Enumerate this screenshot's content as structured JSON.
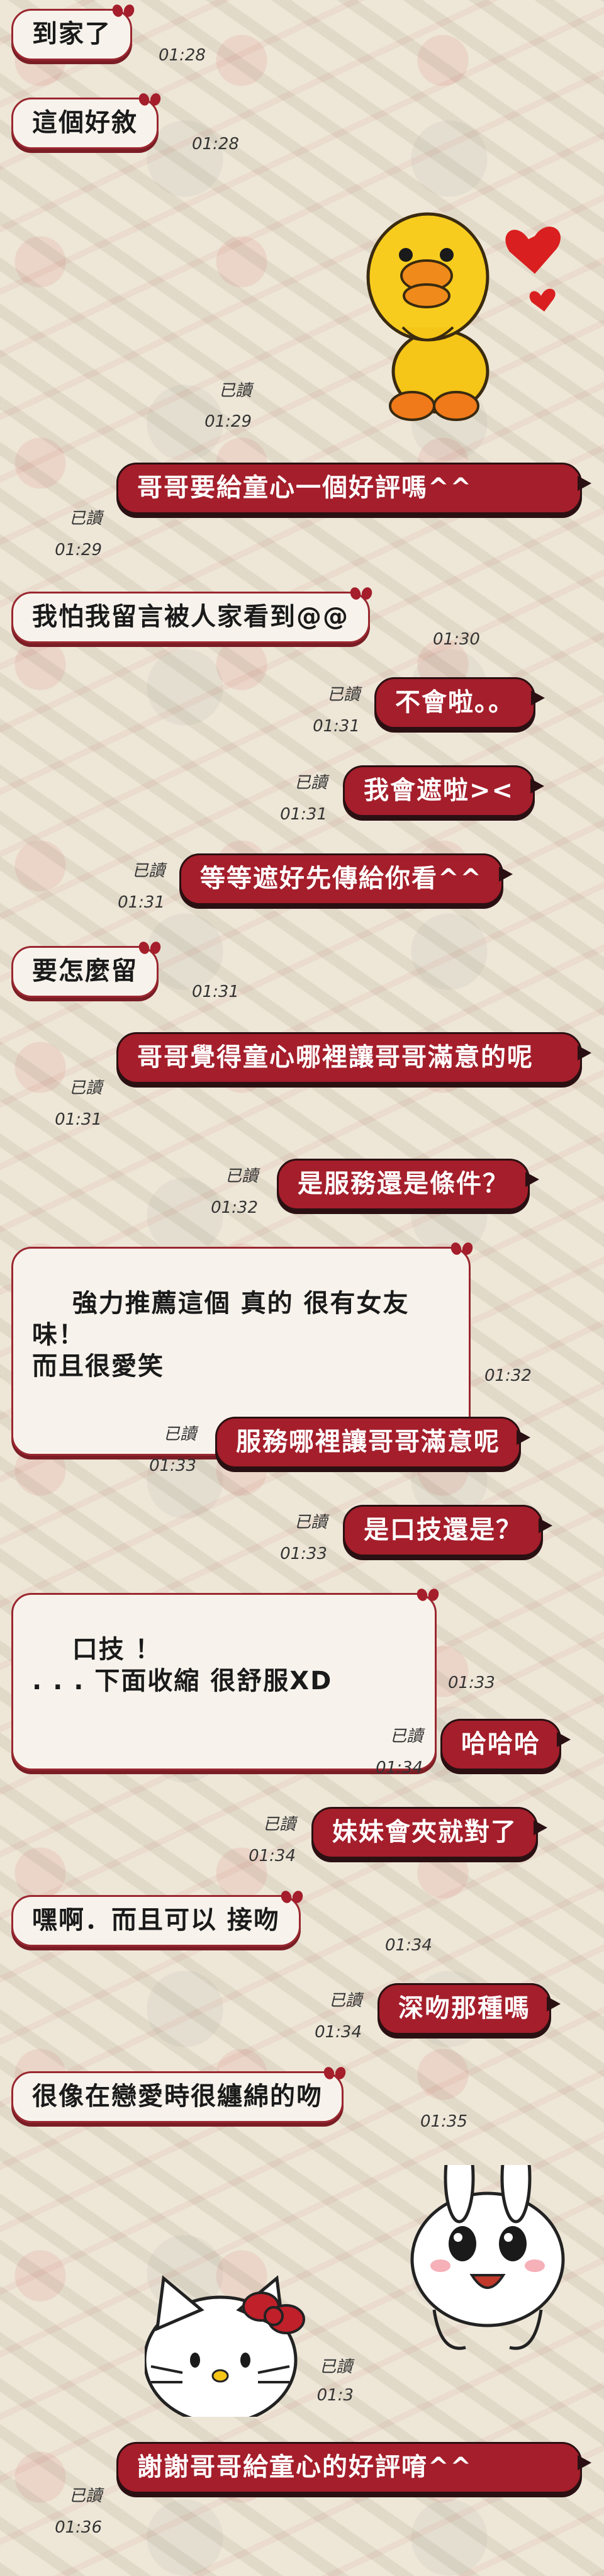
{
  "messages": [
    {
      "side": "in",
      "text": "到家了",
      "time": "01:28"
    },
    {
      "side": "in",
      "text": "這個好敘",
      "time": "01:28"
    },
    {
      "side": "out",
      "sticker": "sally-duck-sticker",
      "read": "已讀",
      "time": "01:29"
    },
    {
      "side": "out",
      "text": "哥哥要給童心一個好評嗎^^",
      "read": "已讀",
      "time": "01:29"
    },
    {
      "side": "in",
      "text": "我怕我留言被人家看到@@",
      "time": "01:30"
    },
    {
      "side": "out",
      "text": "不會啦。。",
      "read": "已讀",
      "time": "01:31"
    },
    {
      "side": "out",
      "text": "我會遮啦><",
      "read": "已讀",
      "time": "01:31"
    },
    {
      "side": "out",
      "text": "等等遮好先傳給你看^^",
      "read": "已讀",
      "time": "01:31"
    },
    {
      "side": "in",
      "text": "要怎麼留",
      "time": "01:31"
    },
    {
      "side": "out",
      "text": "哥哥覺得童心哪裡讓哥哥滿意的呢",
      "read": "已讀",
      "time": "01:31"
    },
    {
      "side": "out",
      "text": "是服務還是條件？",
      "read": "已讀",
      "time": "01:32"
    },
    {
      "side": "in",
      "text": "強力推薦這個 真的 很有女友味！\n而且很愛笑",
      "time": "01:32"
    },
    {
      "side": "out",
      "text": "服務哪裡讓哥哥滿意呢",
      "read": "已讀",
      "time": "01:33"
    },
    {
      "side": "out",
      "text": "是口技還是？",
      "read": "已讀",
      "time": "01:33"
    },
    {
      "side": "in",
      "text": "口技 ！\n. . . 下面收縮 很舒服XD",
      "time": "01:33"
    },
    {
      "side": "out",
      "text": "哈哈哈",
      "read": "已讀",
      "time": "01:34"
    },
    {
      "side": "out",
      "text": "妹妹會夾就對了",
      "read": "已讀",
      "time": "01:34"
    },
    {
      "side": "in",
      "text": "嘿啊．而且可以 接吻",
      "time": "01:34"
    },
    {
      "side": "out",
      "text": "深吻那種嗎",
      "read": "已讀",
      "time": "01:34"
    },
    {
      "side": "in",
      "text": "很像在戀愛時很纏綿的吻",
      "time": "01:35"
    },
    {
      "side": "out",
      "sticker": "kitty-cony-sticker",
      "read": "已讀",
      "time": "01:3"
    },
    {
      "side": "out",
      "text": "謝謝哥哥給童心的好評唷^^",
      "read": "已讀",
      "time": "01:36"
    }
  ]
}
